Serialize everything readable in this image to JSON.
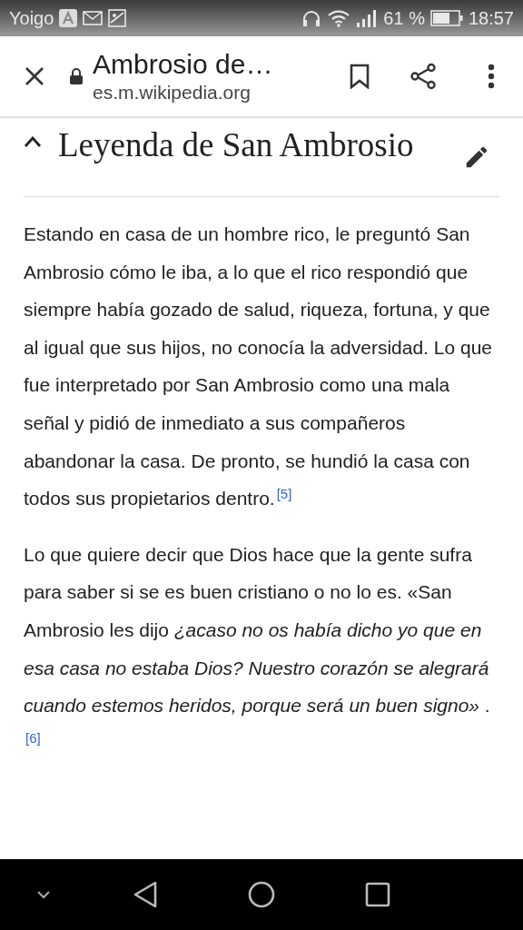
{
  "status_bar": {
    "carrier": "Yoigo",
    "battery": "61 %",
    "time": "18:57"
  },
  "toolbar": {
    "title": "Ambrosio de…",
    "url": "es.m.wikipedia.org"
  },
  "section": {
    "title": "Leyenda de San Ambrosio",
    "expanded": true
  },
  "paragraphs": [
    {
      "text": "Estando en casa de un hombre rico, le preguntó San Ambrosio cómo le iba, a lo que el rico respondió que siempre había gozado de salud, riqueza, fortuna, y que al igual que sus hijos, no conocía la adversidad. Lo que fue interpretado por San Ambrosio como una mala señal y pidió de inmediato a sus compañeros abandonar la casa. De pronto, se hundió la casa con todos sus propietarios dentro.",
      "ref": "[5]"
    },
    {
      "text": "Lo que quiere decir que Dios hace que la gente sufra para saber si se es buen cristiano o no lo es. «San Ambrosio les dijo *¿acaso no os había dicho yo que en esa casa no estaba Dios? Nuestro corazón se alegrará cuando estemos heridos, porque será un buen signo»* .",
      "ref": "[6]"
    }
  ]
}
